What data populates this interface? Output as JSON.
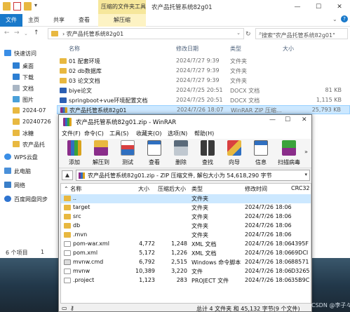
{
  "explorer": {
    "context_tab_header": "压缩的文件夹工具",
    "window_title": "农产品托管系统82g01",
    "ribbon_tabs": [
      "文件",
      "主页",
      "共享",
      "查看",
      "解压缩"
    ],
    "address_path": "农产品托管系统82g01",
    "search_placeholder": "搜索\"农产品托管系统82g01\"",
    "columns": {
      "name": "名称",
      "date": "修改日期",
      "type": "类型",
      "size": "大小"
    },
    "nav_items": [
      "快速访问",
      "桌面",
      "下载",
      "文档",
      "图片",
      "2024-07",
      "20240726",
      "冰糖",
      "农产品托",
      "WPS云盘",
      "此电脑",
      "网络",
      "百度网盘同步"
    ],
    "files": [
      {
        "name": "01 配套环境",
        "date": "2024/7/27 9:39",
        "type": "文件夹",
        "size": ""
      },
      {
        "name": "02 db数据库",
        "date": "2024/7/27 9:39",
        "type": "文件夹",
        "size": ""
      },
      {
        "name": "03 论文文档",
        "date": "2024/7/27 9:39",
        "type": "文件夹",
        "size": ""
      },
      {
        "name": "biye论文",
        "date": "2024/7/25 20:51",
        "type": "DOCX 文档",
        "size": "81 KB"
      },
      {
        "name": "springboot+vue环境配置文档",
        "date": "2024/7/25 20:51",
        "type": "DOCX 文档",
        "size": "1,115 KB"
      },
      {
        "name": "农产品托管系统82g01",
        "date": "2024/7/26 18:07",
        "type": "WinRAR ZIP 压缩...",
        "size": "25,793 KB"
      }
    ],
    "status_text": "6 个项目",
    "status_text2": "1"
  },
  "winrar": {
    "title": "农产品托管系统82g01.zip - WinRAR",
    "menu": [
      "文件(F)",
      "命令(C)",
      "工具(S)",
      "收藏夹(O)",
      "选项(N)",
      "帮助(H)"
    ],
    "toolbar": [
      "添加",
      "解压到",
      "测试",
      "查看",
      "删除",
      "查找",
      "向导",
      "信息",
      "扫描病毒"
    ],
    "archive_path": "农产品托管系统82g01.zip - ZIP 压缩文件, 解包大小为 54,618,290 字节",
    "columns": {
      "name": "名称",
      "size": "大小",
      "packed": "压缩后大小",
      "type": "类型",
      "modified": "修改时间",
      "crc": "CRC32"
    },
    "rows": [
      {
        "name": "..",
        "size": "",
        "packed": "",
        "type": "文件夹",
        "modified": "",
        "crc": ""
      },
      {
        "name": "target",
        "size": "",
        "packed": "",
        "type": "文件夹",
        "modified": "2024/7/26 18:06",
        "crc": ""
      },
      {
        "name": "src",
        "size": "",
        "packed": "",
        "type": "文件夹",
        "modified": "2024/7/26 18:06",
        "crc": ""
      },
      {
        "name": "db",
        "size": "",
        "packed": "",
        "type": "文件夹",
        "modified": "2024/7/26 18:06",
        "crc": ""
      },
      {
        "name": ".mvn",
        "size": "",
        "packed": "",
        "type": "文件夹",
        "modified": "2024/7/26 18:06",
        "crc": ""
      },
      {
        "name": "pom-war.xml",
        "size": "4,772",
        "packed": "1,248",
        "type": "XML 文档",
        "modified": "2024/7/26 18:06",
        "crc": "4395F"
      },
      {
        "name": "pom.xml",
        "size": "5,172",
        "packed": "1,226",
        "type": "XML 文档",
        "modified": "2024/7/26 18:06",
        "crc": "69DCI"
      },
      {
        "name": "mvnw.cmd",
        "size": "6,792",
        "packed": "2,515",
        "type": "Windows 命令脚本",
        "modified": "2024/7/26 18:06",
        "crc": "88571"
      },
      {
        "name": "mvnw",
        "size": "10,389",
        "packed": "3,220",
        "type": "文件",
        "modified": "2024/7/26 18:06",
        "crc": "D3265"
      },
      {
        "name": ".project",
        "size": "1,123",
        "packed": "283",
        "type": "PROJECT 文件",
        "modified": "2024/7/26 18:06",
        "crc": "35B9C"
      }
    ],
    "status_right": "总计 4 文件夹 和 45,132 字节(9 个文件)"
  },
  "watermark": "CSDN @李子々"
}
